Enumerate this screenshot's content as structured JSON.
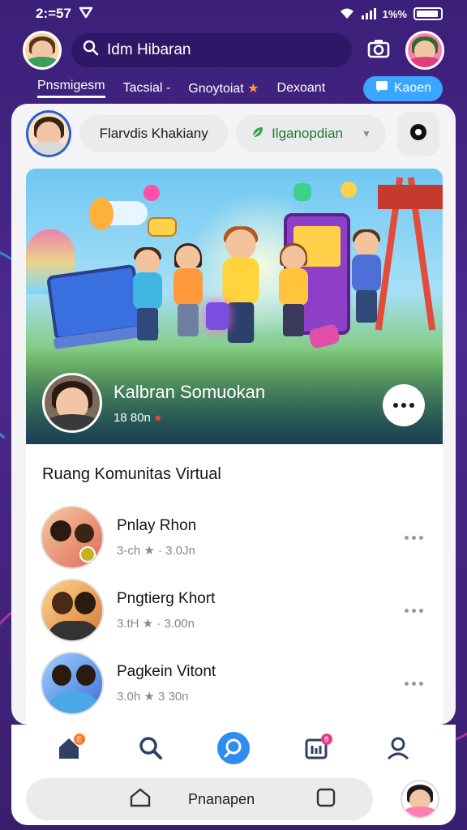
{
  "status": {
    "time": "2:=57",
    "battery_text": "1%%"
  },
  "header": {
    "search_placeholder": "Idm Hibaran"
  },
  "categories": [
    {
      "label": "Pnsmigesm"
    },
    {
      "label": "Tacsial -"
    },
    {
      "label": "Gnoytoiat"
    },
    {
      "label": "Dexoant"
    },
    {
      "label": "Kaoen"
    }
  ],
  "subheader": {
    "name_pill": "Flarvdis Khakiany",
    "mode_pill": "Ilganopdian"
  },
  "banner": {
    "title": "Kalbran Somuokan",
    "meta": "18 80n"
  },
  "section": {
    "title": "Ruang Komunitas Virtual"
  },
  "rooms": [
    {
      "name": "Pnlay Rhon",
      "meta": "3-ch  ★ · 3.0Jn"
    },
    {
      "name": "Pngtierg Khort",
      "meta": "3.tH  ★ · 3.00n"
    },
    {
      "name": "Pagkein Vitont",
      "meta": "3.0h  ★  3 30n"
    }
  ],
  "bottom_nav": {
    "home_badge": "E",
    "grid_badge": "8"
  },
  "system_nav": {
    "label": "Pnanapen"
  },
  "colors": {
    "accent": "#3aa6ff",
    "background": "#3b1f78",
    "card": "#f4f4f6"
  }
}
